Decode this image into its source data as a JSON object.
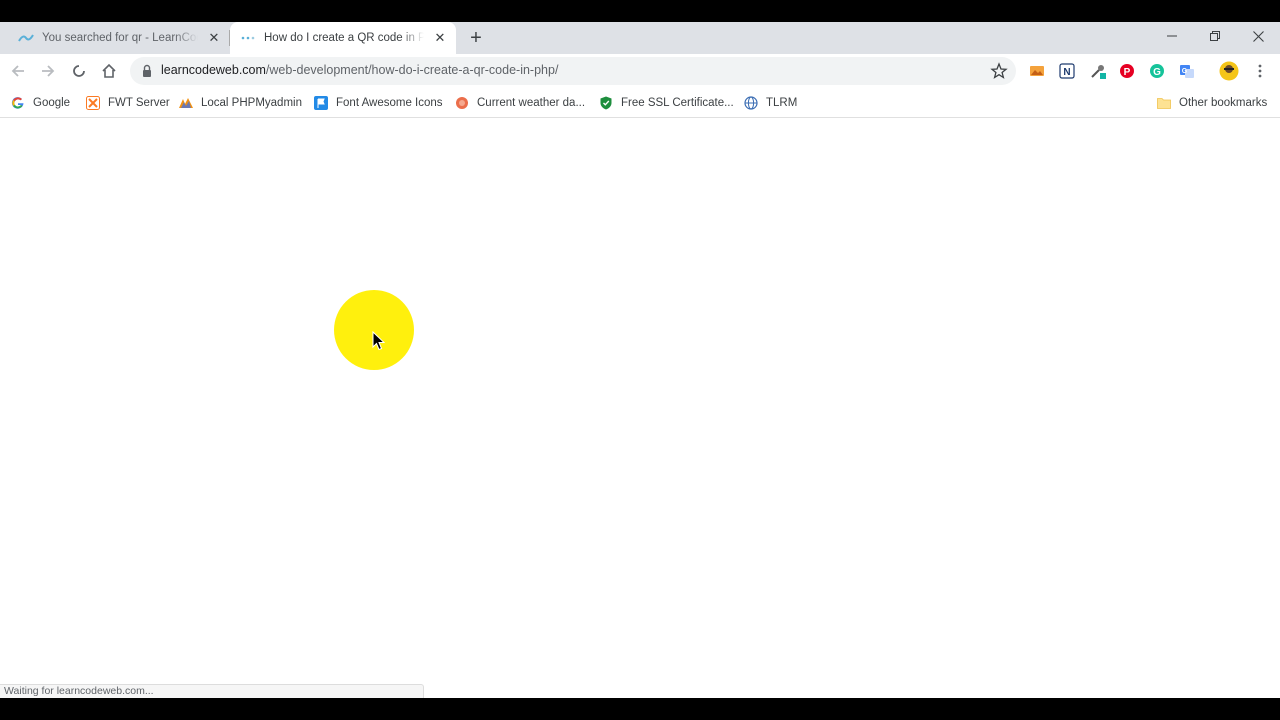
{
  "tabs": [
    {
      "title": "You searched for qr - LearnCodeWeb",
      "active": false
    },
    {
      "title": "How do I create a QR code in PHP",
      "active": true
    }
  ],
  "toolbar": {
    "url_host": "learncodeweb.com",
    "url_path": "/web-development/how-do-i-create-a-qr-code-in-php/"
  },
  "bookmarks": [
    {
      "label": "Google",
      "icon": "google-icon"
    },
    {
      "label": "FWT Server",
      "icon": "xampp-icon"
    },
    {
      "label": "Local PHPMyadmin",
      "icon": "phpmyadmin-icon"
    },
    {
      "label": "Font Awesome Icons",
      "icon": "flag-icon"
    },
    {
      "label": "Current weather da...",
      "icon": "weather-icon"
    },
    {
      "label": "Free SSL Certificate...",
      "icon": "shield-icon"
    },
    {
      "label": "TLRM",
      "icon": "globe-icon"
    }
  ],
  "other_bookmarks": "Other bookmarks",
  "status": "Waiting for learncodeweb.com...",
  "colors": {
    "accent": "#1a73e8",
    "cursor_highlight": "#ffef00"
  }
}
